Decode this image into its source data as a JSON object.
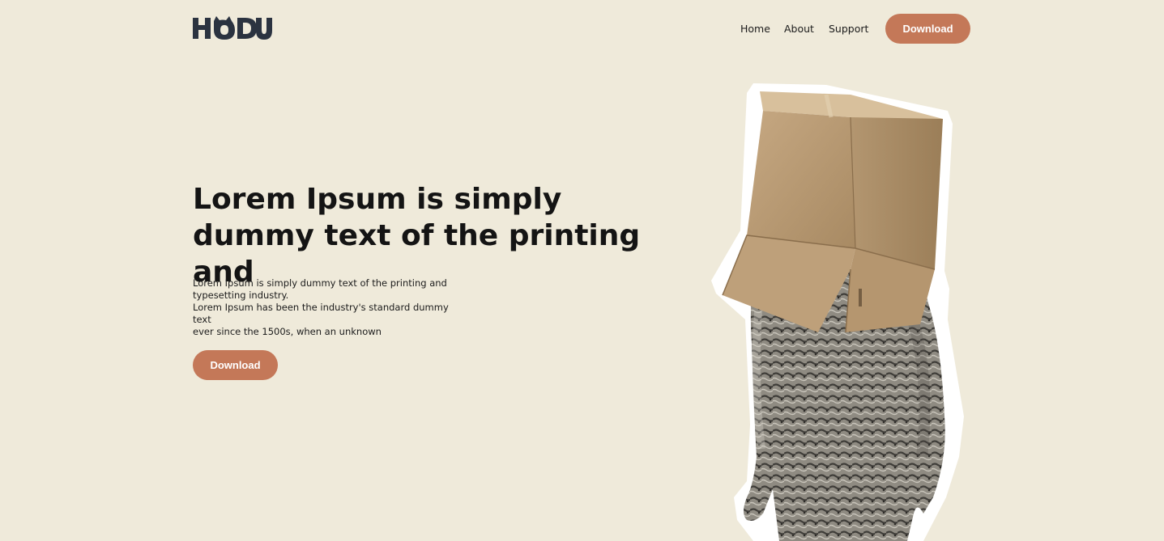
{
  "brand": {
    "logo_text": "HODU"
  },
  "nav": {
    "items": [
      "Home",
      "About",
      "Support"
    ],
    "download_label": "Download"
  },
  "hero": {
    "title_line1": "Lorem Ipsum is simply",
    "title_line2": "dummy text of the printing and",
    "desc_line1": "Lorem Ipsum is simply dummy text of the printing and",
    "desc_line2": "typesetting industry.",
    "desc_line3": "Lorem Ipsum has been the industry's standard dummy text",
    "desc_line4": "ever since the 1500s, when an unknown",
    "download_label": "Download"
  },
  "colors": {
    "background": "#EFEADA",
    "accent": "#C47858",
    "logo": "#2B3340"
  }
}
